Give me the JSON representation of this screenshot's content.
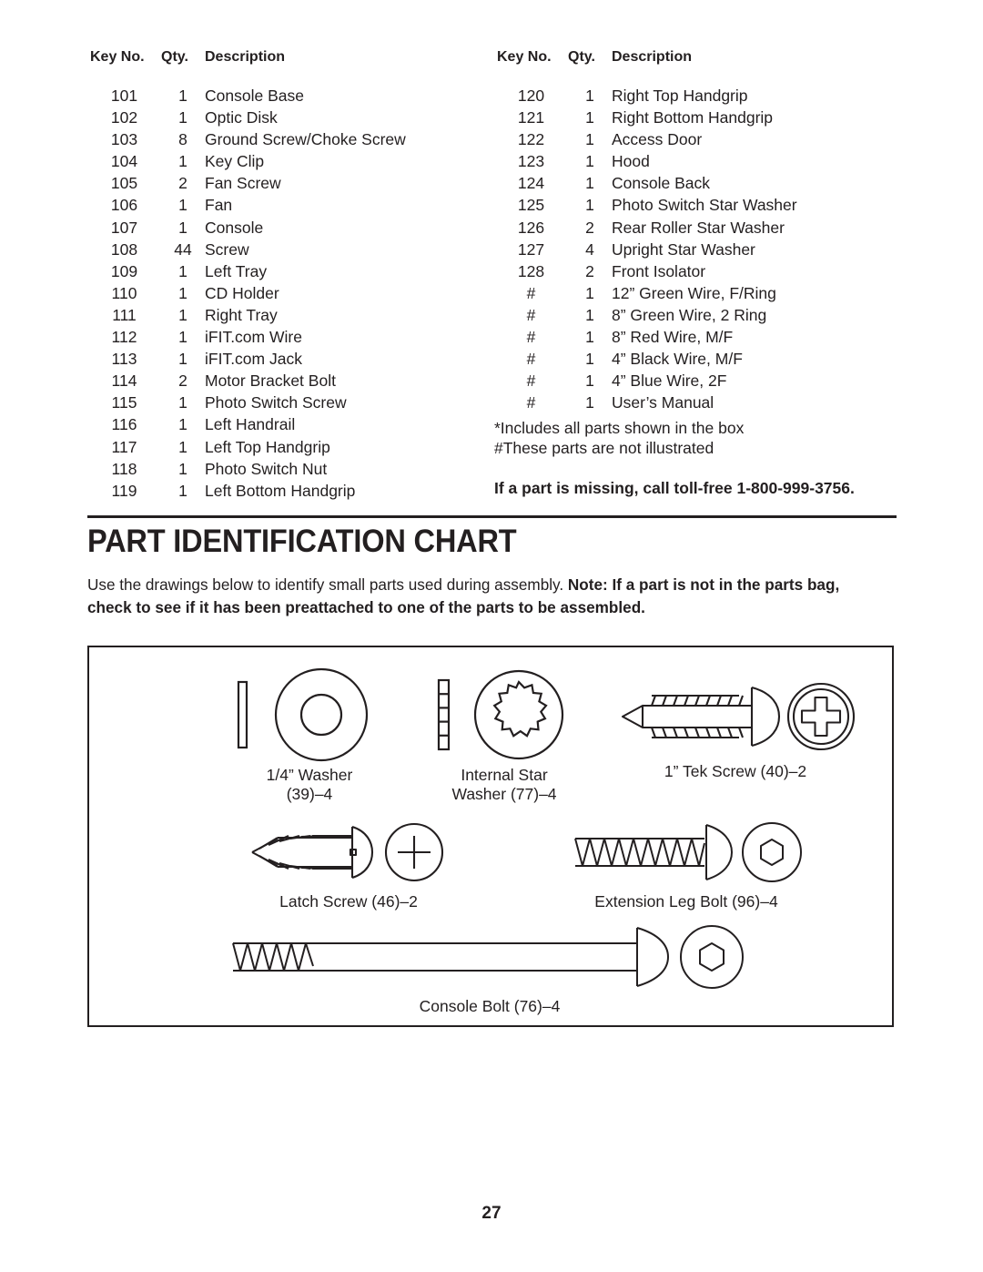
{
  "parts_list": {
    "columns": [
      "Key No.",
      "Qty.",
      "Description"
    ],
    "left_rows": [
      {
        "key": "101",
        "qty": "1",
        "desc": "Console Base"
      },
      {
        "key": "102",
        "qty": "1",
        "desc": "Optic Disk"
      },
      {
        "key": "103",
        "qty": "8",
        "desc": "Ground Screw/Choke Screw"
      },
      {
        "key": "104",
        "qty": "1",
        "desc": "Key Clip"
      },
      {
        "key": "105",
        "qty": "2",
        "desc": "Fan Screw"
      },
      {
        "key": "106",
        "qty": "1",
        "desc": "Fan"
      },
      {
        "key": "107",
        "qty": "1",
        "desc": "Console"
      },
      {
        "key": "108",
        "qty": "44",
        "desc": "Screw"
      },
      {
        "key": "109",
        "qty": "1",
        "desc": "Left Tray"
      },
      {
        "key": "110",
        "qty": "1",
        "desc": "CD Holder"
      },
      {
        "key": "111",
        "qty": "1",
        "desc": "Right Tray"
      },
      {
        "key": "112",
        "qty": "1",
        "desc": "iFIT.com Wire"
      },
      {
        "key": "113",
        "qty": "1",
        "desc": "iFIT.com Jack"
      },
      {
        "key": "114",
        "qty": "2",
        "desc": "Motor Bracket Bolt"
      },
      {
        "key": "115",
        "qty": "1",
        "desc": "Photo Switch Screw"
      },
      {
        "key": "116",
        "qty": "1",
        "desc": "Left Handrail"
      },
      {
        "key": "117",
        "qty": "1",
        "desc": "Left Top Handgrip"
      },
      {
        "key": "118",
        "qty": "1",
        "desc": "Photo Switch Nut"
      },
      {
        "key": "119",
        "qty": "1",
        "desc": "Left Bottom Handgrip"
      }
    ],
    "right_rows": [
      {
        "key": "120",
        "qty": "1",
        "desc": "Right Top Handgrip"
      },
      {
        "key": "121",
        "qty": "1",
        "desc": "Right Bottom Handgrip"
      },
      {
        "key": "122",
        "qty": "1",
        "desc": "Access Door"
      },
      {
        "key": "123",
        "qty": "1",
        "desc": "Hood"
      },
      {
        "key": "124",
        "qty": "1",
        "desc": "Console Back"
      },
      {
        "key": "125",
        "qty": "1",
        "desc": "Photo Switch Star Washer"
      },
      {
        "key": "126",
        "qty": "2",
        "desc": "Rear Roller Star Washer"
      },
      {
        "key": "127",
        "qty": "4",
        "desc": "Upright Star Washer"
      },
      {
        "key": "128",
        "qty": "2",
        "desc": "Front Isolator"
      },
      {
        "key": "#",
        "qty": "1",
        "desc": "12” Green Wire, F/Ring"
      },
      {
        "key": "#",
        "qty": "1",
        "desc": "8” Green Wire, 2 Ring"
      },
      {
        "key": "#",
        "qty": "1",
        "desc": "8” Red Wire, M/F"
      },
      {
        "key": "#",
        "qty": "1",
        "desc": "4” Black Wire, M/F"
      },
      {
        "key": "#",
        "qty": "1",
        "desc": "4” Blue Wire, 2F"
      },
      {
        "key": "#",
        "qty": "1",
        "desc": "User’s Manual"
      }
    ],
    "footnote_asterisk": "*Includes all parts shown in the box",
    "footnote_hash": "#These parts are not illustrated",
    "missing_part_notice": "If a part is missing, call toll-free 1-800-999-3756."
  },
  "section": {
    "title": "PART IDENTIFICATION CHART",
    "intro_plain": "Use the drawings below to identify small parts used during assembly. ",
    "intro_bold": "Note: If a part is not in the parts bag, check to see if it has been preattached to one of the parts to be assembled."
  },
  "chart": {
    "figures": [
      {
        "id": "washer",
        "label": "1/4” Washer\n(39)–4",
        "icon": "flat-washer-icon"
      },
      {
        "id": "star",
        "label": "Internal Star\nWasher (77)–4",
        "icon": "internal-star-washer-icon"
      },
      {
        "id": "tek",
        "label": "1” Tek Screw (40)–2",
        "icon": "tek-screw-icon"
      },
      {
        "id": "latch",
        "label": "Latch Screw (46)–2",
        "icon": "latch-screw-icon"
      },
      {
        "id": "extleg",
        "label": "Extension Leg Bolt (96)–4",
        "icon": "extension-leg-bolt-icon"
      },
      {
        "id": "console",
        "label": "Console Bolt (76)–4",
        "icon": "console-bolt-icon"
      }
    ]
  },
  "page_number": "27",
  "colors": {
    "ink": "#231f20",
    "paper": "#ffffff"
  }
}
